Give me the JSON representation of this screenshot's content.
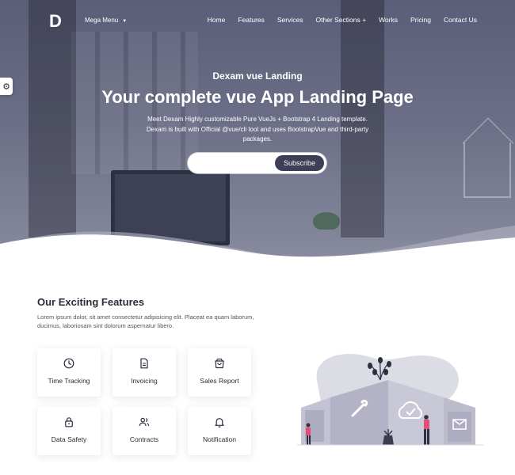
{
  "nav": {
    "logo": "D",
    "mega_menu": "Mega Menu",
    "links": [
      "Home",
      "Features",
      "Services",
      "Other Sections +",
      "Works",
      "Pricing",
      "Contact Us"
    ]
  },
  "hero": {
    "subtitle": "Dexam vue Landing",
    "title": "Your complete vue App Landing Page",
    "description": "Meet Dexam Highly customizable Pure VueJs + Bootstrap 4 Landing template. Dexam is built with Official @vue/cli tool and uses BootstrapVue and third-party packages.",
    "subscribe_placeholder": "",
    "subscribe_button": "Subscribe"
  },
  "features": {
    "title": "Our Exciting Features",
    "description": "Lorem ipsum dolor, sit amet consectetur adipisicing elit. Placeat ea quam laborum, ducimus, laboriosam sint dolorum aspernatur libero.",
    "items": [
      {
        "label": "Time Tracking",
        "icon": "clock-icon"
      },
      {
        "label": "Invoicing",
        "icon": "document-icon"
      },
      {
        "label": "Sales Report",
        "icon": "shopping-bag-icon"
      },
      {
        "label": "Data Safety",
        "icon": "lock-icon"
      },
      {
        "label": "Contracts",
        "icon": "users-icon"
      },
      {
        "label": "Notification",
        "icon": "bell-icon"
      }
    ]
  },
  "colors": {
    "accent": "#3c3f56",
    "hero_overlay": "#5b5e78",
    "illustration": "#bdbccb",
    "highlight": "#e0507b"
  },
  "icons": {
    "settings": "gear-icon",
    "dropdown": "caret-down-icon"
  }
}
